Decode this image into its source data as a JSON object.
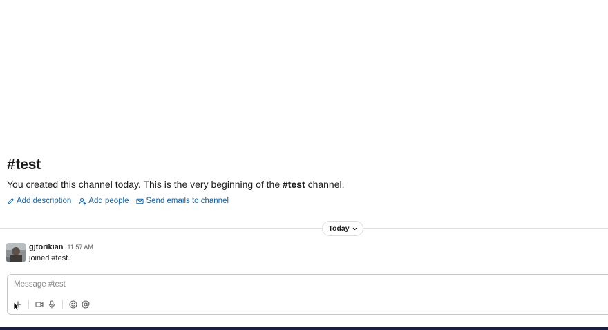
{
  "channel": {
    "hash": "#",
    "name": "test",
    "intro_prefix": "You created this channel today. This is the very beginning of the ",
    "intro_channel": "#test",
    "intro_suffix": " channel."
  },
  "actions": {
    "add_description": "Add description",
    "add_people": "Add people",
    "send_emails": "Send emails to channel"
  },
  "divider": {
    "date_label": "Today"
  },
  "message": {
    "username": "gjtorikian",
    "timestamp": "11:57 AM",
    "text": "joined #test."
  },
  "composer": {
    "placeholder": "Message #test"
  },
  "icons": {
    "pencil": "pencil-icon",
    "add_person": "add-person-icon",
    "email": "email-icon",
    "chevron": "chevron-down-icon",
    "plus": "plus-icon",
    "video": "video-icon",
    "microphone": "microphone-icon",
    "emoji": "emoji-icon",
    "mention": "mention-icon"
  },
  "colors": {
    "link": "#1264a3",
    "text": "#1d1c1d",
    "muted": "#616061",
    "bottom_bar": "#1a1d3f"
  }
}
